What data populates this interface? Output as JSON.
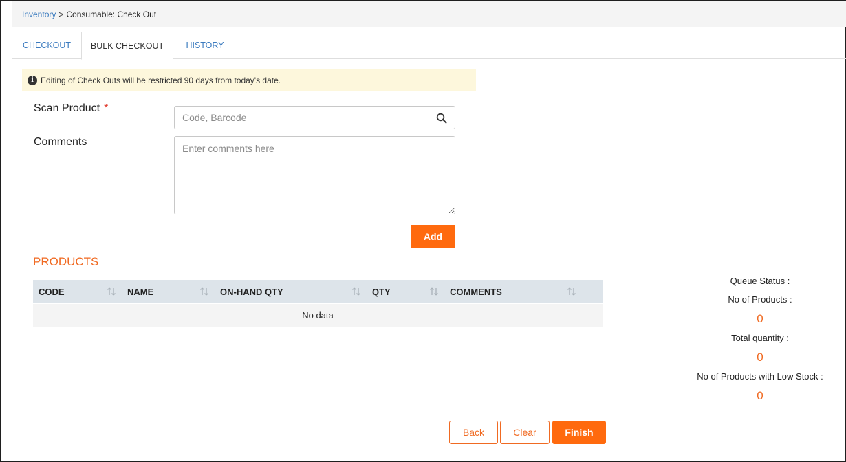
{
  "breadcrumb": {
    "link": "Inventory",
    "separator": ">",
    "current": "Consumable: Check Out"
  },
  "tabs": [
    {
      "label": "CHECKOUT",
      "active": false
    },
    {
      "label": "BULK CHECKOUT",
      "active": true
    },
    {
      "label": "HISTORY",
      "active": false
    }
  ],
  "notice": {
    "icon": "info-icon",
    "text": "Editing of Check Outs will be restricted 90 days from today's date."
  },
  "form": {
    "scan_label": "Scan Product",
    "required_mark": "*",
    "scan_placeholder": "Code, Barcode",
    "scan_value": "",
    "comments_label": "Comments",
    "comments_placeholder": "Enter comments here",
    "comments_value": "",
    "add_label": "Add"
  },
  "products": {
    "title": "PRODUCTS",
    "columns": [
      "CODE",
      "NAME",
      "ON-HAND QTY",
      "QTY",
      "COMMENTS"
    ],
    "empty_text": "No data",
    "rows": []
  },
  "queue": {
    "title": "Queue Status :",
    "no_products_label": "No of Products :",
    "no_products_value": "0",
    "total_qty_label": "Total quantity :",
    "total_qty_value": "0",
    "low_stock_label": "No of Products with Low Stock :",
    "low_stock_value": "0"
  },
  "actions": {
    "back_label": "Back",
    "clear_label": "Clear",
    "finish_label": "Finish"
  },
  "colors": {
    "accent": "#ff6a0e",
    "link": "#3b7bbf",
    "notice_bg": "#fdf7dc",
    "table_header_bg": "#dde4ea"
  }
}
